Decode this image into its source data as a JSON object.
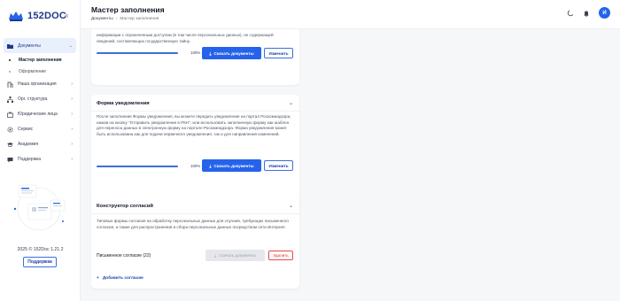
{
  "app": {
    "logo_text": "152DOC",
    "collapse_icon": "chevron-double-left-icon"
  },
  "sidebar": {
    "items": [
      {
        "label": "Документы",
        "icon": "folder-icon"
      },
      {
        "label": "Наша организация",
        "icon": "building-icon"
      },
      {
        "label": "Орг. структура",
        "icon": "org-structure-icon"
      },
      {
        "label": "Юридические лица",
        "icon": "legal-entity-icon"
      },
      {
        "label": "Сервис",
        "icon": "gear-icon"
      },
      {
        "label": "Академия",
        "icon": "graduation-cap-icon"
      },
      {
        "label": "Поддержка",
        "icon": "chat-icon"
      }
    ],
    "sub_items": [
      {
        "label": "Мастер заполнения"
      },
      {
        "label": "Оформление"
      }
    ],
    "version": "2025 © 152Doc 1.21.2",
    "support_button": "Поддержка"
  },
  "header": {
    "title": "Мастер заполнения",
    "breadcrumb": [
      "Документы",
      "Мастер заполнения"
    ],
    "avatar_letter": "И"
  },
  "cards": {
    "top": {
      "text": "информации с ограниченным доступом (в том числе персональных данных), не содержащей сведений, составляющих государственную тайну.",
      "progress": 100,
      "progress_label": "100%",
      "download": "Скачать документы",
      "edit": "Изменить"
    },
    "notify": {
      "title": "Форма уведомления",
      "text": "После заполнения Формы уведомления, вы можете передать уведомление на портал Роскомнадзора, нажав на кнопку \"Отправить уведомление в РКН\", или использовать заполненную форму как шаблон для переноса данных в электронную форму на портале Роскомнадзора. Форма уведомления может быть использована как для подачи первичного уведомления, так и для направления изменений.",
      "progress": 100,
      "progress_label": "100%",
      "download": "Скачать документы",
      "edit": "Изменить"
    },
    "consent": {
      "title": "Конструктор согласий",
      "text": "Типовые формы согласия на обработку персональных данных для случаев, требующих письменного согласия, а также для распространения и сбора персональных данных посредством сети Интернет.",
      "item_label": "Письменное согласие (22)",
      "download": "Скачать документы",
      "delete": "Удалить",
      "add_link": "Добавить согласие"
    }
  },
  "colors": {
    "primary": "#2563eb",
    "danger": "#ef4444",
    "active_bg": "#e8effd"
  }
}
